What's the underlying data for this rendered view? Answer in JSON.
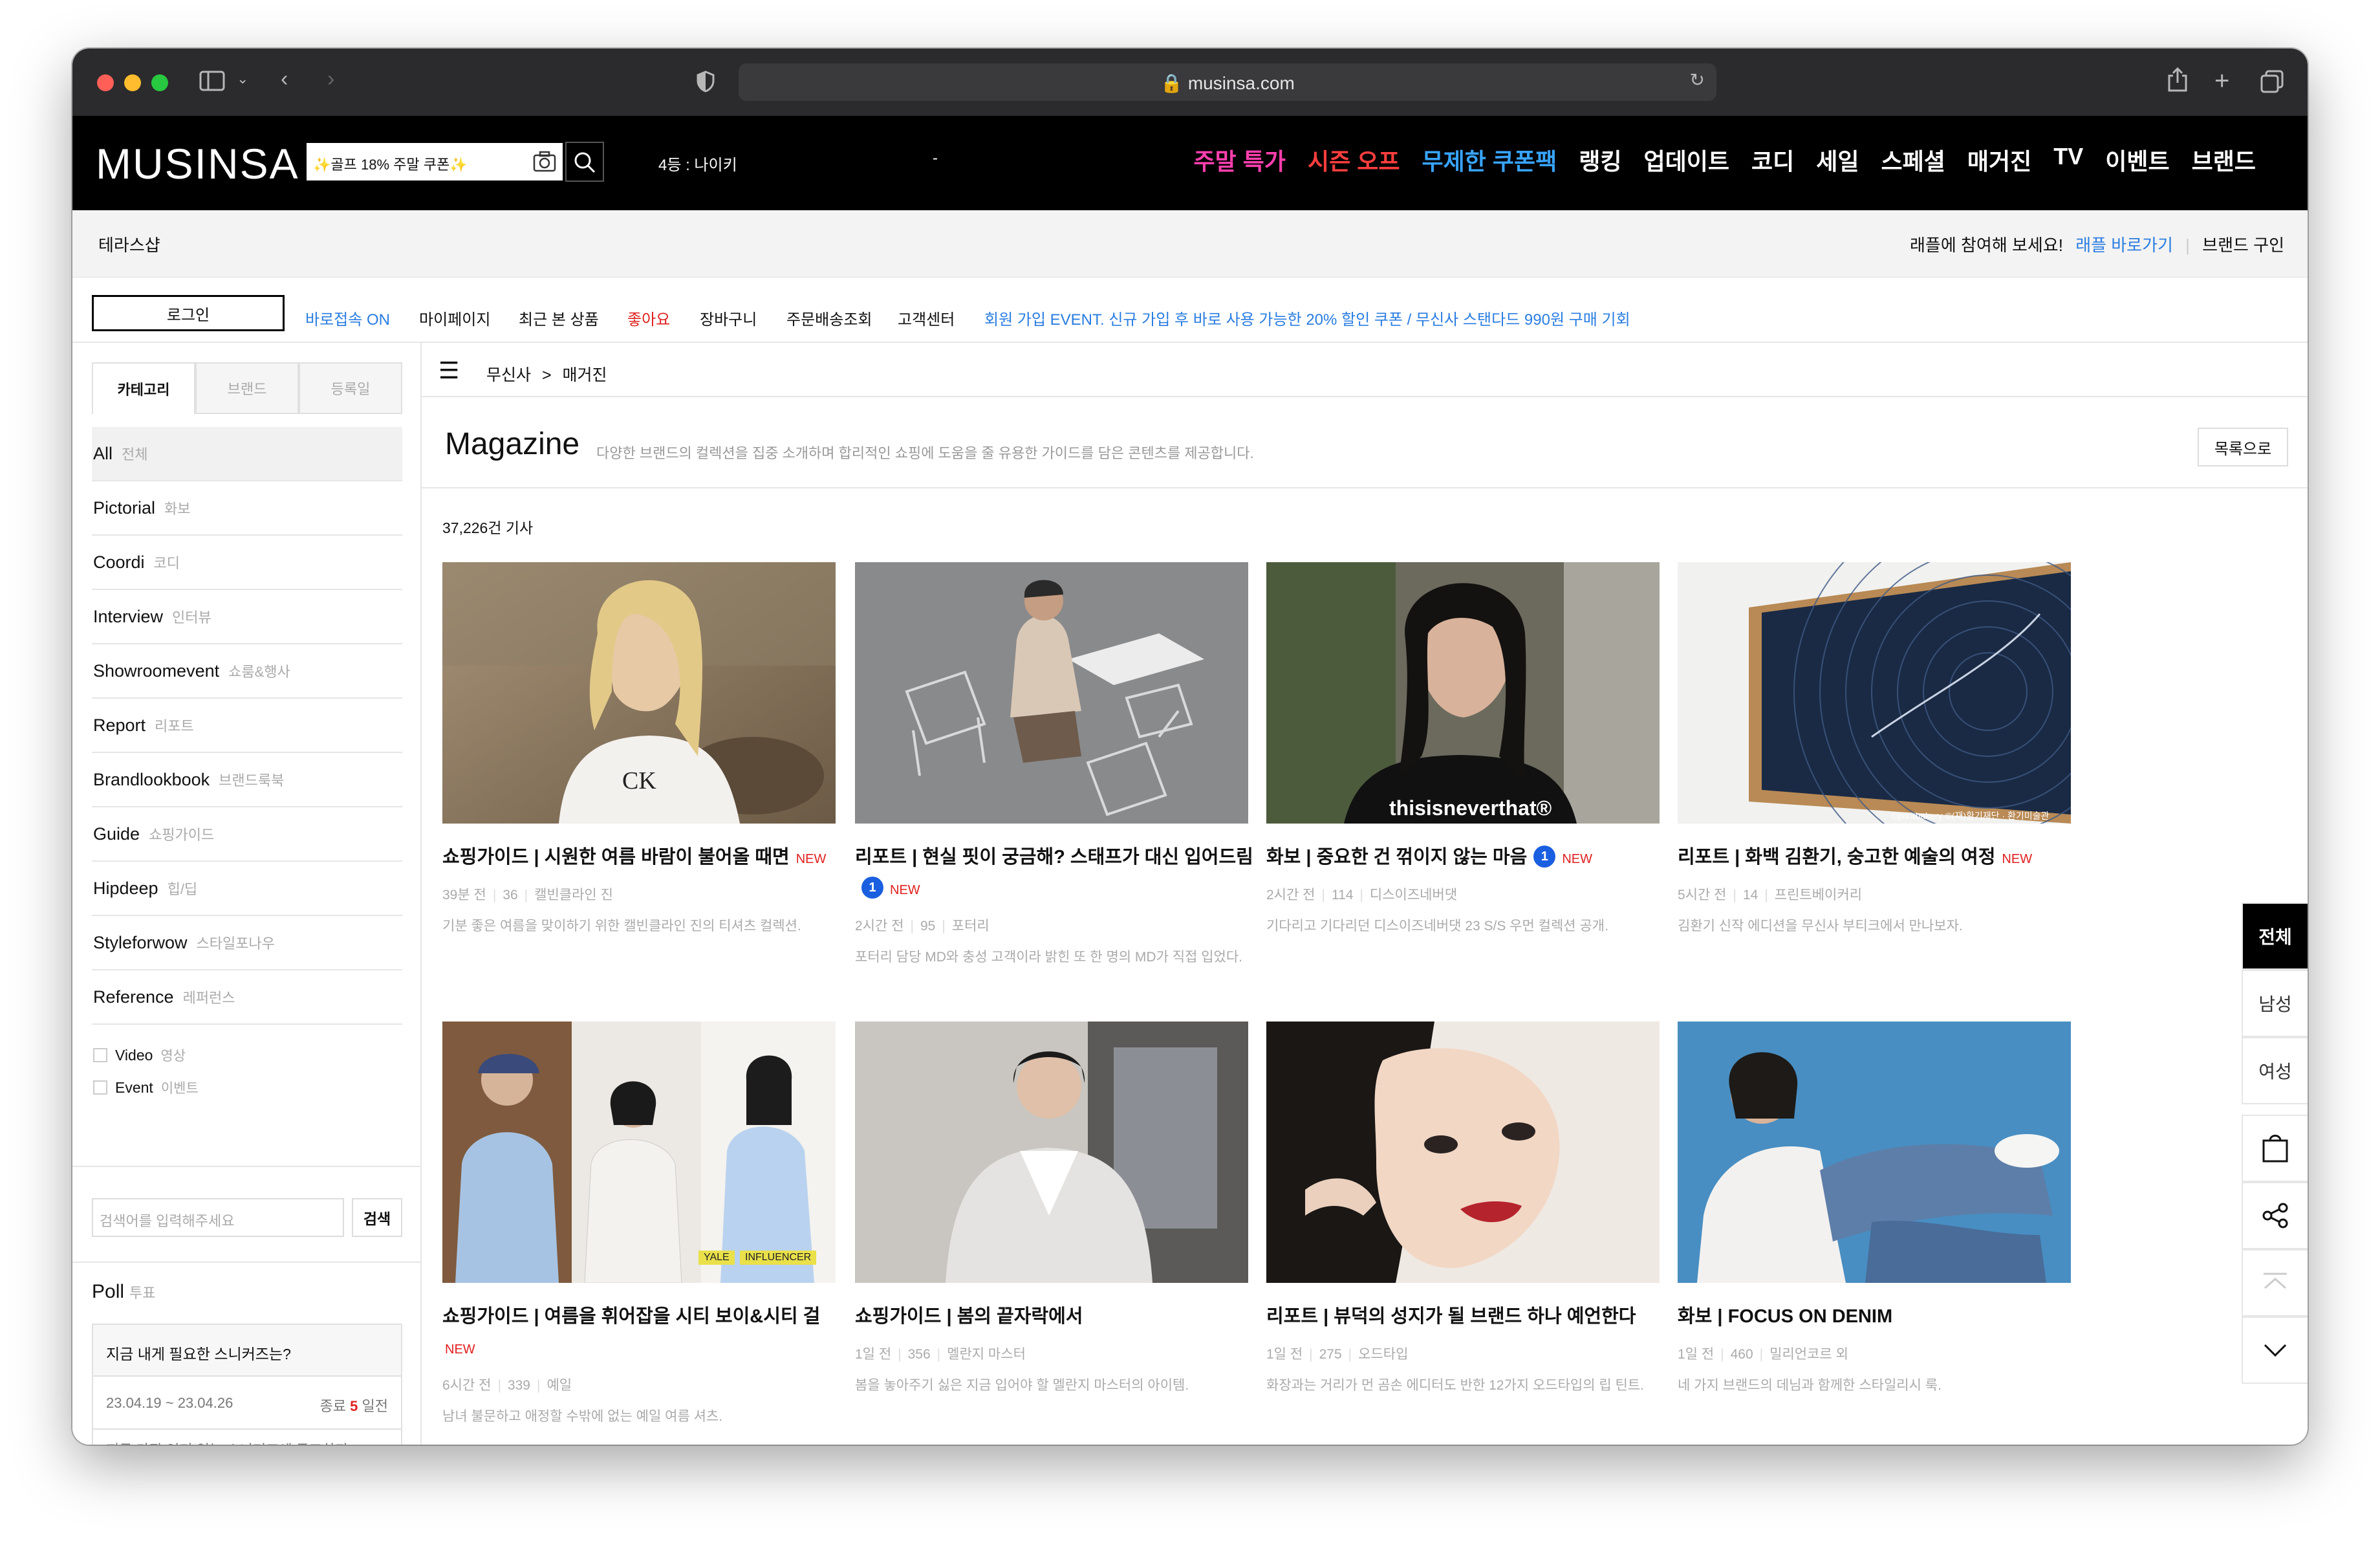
{
  "browser": {
    "url": "musinsa.com",
    "traffic_lights": [
      "#ff5f57",
      "#febc2e",
      "#28c840"
    ]
  },
  "header": {
    "logo": "MUSINSA",
    "search_placeholder": "✨골프 18% 주말 쿠폰✨",
    "rank_text": "4등 : 나이키",
    "rank_dash": "-",
    "nav": [
      {
        "label": "주말 특가",
        "color": "#ff3fae"
      },
      {
        "label": "시즌 오프",
        "color": "#ff3e3e"
      },
      {
        "label": "무제한 쿠폰팩",
        "color": "#38a4ff"
      },
      {
        "label": "랭킹",
        "color": "#ffffff"
      },
      {
        "label": "업데이트",
        "color": "#ffffff"
      },
      {
        "label": "코디",
        "color": "#ffffff"
      },
      {
        "label": "세일",
        "color": "#ffffff"
      },
      {
        "label": "스페셜",
        "color": "#ffffff"
      },
      {
        "label": "매거진",
        "color": "#ffffff"
      },
      {
        "label": "TV",
        "color": "#ffffff"
      },
      {
        "label": "이벤트",
        "color": "#ffffff"
      },
      {
        "label": "브랜드",
        "color": "#ffffff"
      }
    ]
  },
  "subbar": {
    "left": "테라스샵",
    "raffle_text": "래플에 참여해 보세요!",
    "raffle_link": "래플 바로가기",
    "brand_link": "브랜드 구인"
  },
  "util": {
    "login": "로그인",
    "quick_on": "바로접속 ON",
    "items": [
      "마이페이지",
      "최근 본 상품",
      "좋아요",
      "장바구니",
      "주문배송조회",
      "고객센터"
    ],
    "promo": "회원 가입 EVENT. 신규 가입 후 바로 사용 가능한 20% 할인 쿠폰 / 무신사 스탠다드 990원 구매 기회"
  },
  "sidebar": {
    "tabs": [
      "카테고리",
      "브랜드",
      "등록일"
    ],
    "categories": [
      {
        "en": "All",
        "ko": "전체"
      },
      {
        "en": "Pictorial",
        "ko": "화보"
      },
      {
        "en": "Coordi",
        "ko": "코디"
      },
      {
        "en": "Interview",
        "ko": "인터뷰"
      },
      {
        "en": "Showroomevent",
        "ko": "쇼룸&행사"
      },
      {
        "en": "Report",
        "ko": "리포트"
      },
      {
        "en": "Brandlookbook",
        "ko": "브랜드룩북"
      },
      {
        "en": "Guide",
        "ko": "쇼핑가이드"
      },
      {
        "en": "Hipdeep",
        "ko": "힙/딥"
      },
      {
        "en": "Styleforwow",
        "ko": "스타일포나우"
      },
      {
        "en": "Reference",
        "ko": "레퍼런스"
      }
    ],
    "checks": [
      {
        "en": "Video",
        "ko": "영상"
      },
      {
        "en": "Event",
        "ko": "이벤트"
      }
    ],
    "search_placeholder": "검색어를 입력해주세요",
    "search_button": "검색",
    "poll_title": "Poll",
    "poll_title_ko": "투표",
    "poll_question": "지금 내게 필요한 스니커즈는?",
    "poll_date": "23.04.19 ~ 23.04.26",
    "poll_end_prefix": "종료",
    "poll_end_days": "5",
    "poll_end_suffix": "일전",
    "poll_desc": "지금 가장 인기 있는 스니커즈에 투표하자."
  },
  "breadcrumb": {
    "home": "무신사",
    "sep": ">",
    "current": "매거진"
  },
  "magazine": {
    "title": "Magazine",
    "description": "다양한 브랜드의 컬렉션을 집중 소개하며 합리적인 쇼핑에 도움을 줄 유용한 가이드를 담은 콘텐츠를 제공합니다.",
    "list_button": "목록으로",
    "count": "37,226건 기사"
  },
  "articles": [
    {
      "title": "쇼핑가이드 | 시원한 여름 바람이 불어올 때면",
      "new": "NEW",
      "badge": "",
      "time": "39분 전",
      "views": "36",
      "author": "캘빈클라인 진",
      "desc": "기분 좋은 여름을 맞이하기 위한 캘빈클라인 진의 티셔츠 컬렉션."
    },
    {
      "title": "리포트 | 현실 핏이 궁금해? 스태프가 대신 입어드림",
      "new": "NEW",
      "badge": "1",
      "time": "2시간 전",
      "views": "95",
      "author": "포터리",
      "desc": "포터리 담당 MD와 충성 고객이라 밝힌 또 한 명의 MD가 직접 입었다."
    },
    {
      "title": "화보 | 중요한 건 꺾이지 않는 마음",
      "new": "NEW",
      "badge": "1",
      "time": "2시간 전",
      "views": "114",
      "author": "디스이즈네버댓",
      "desc": "기다리고 기다리던 디스이즈네버댓 23 S/S 우먼 컬렉션 공개."
    },
    {
      "title": "리포트 | 화백 김환기, 숭고한 예술의 여정",
      "new": "NEW",
      "badge": "",
      "time": "5시간 전",
      "views": "14",
      "author": "프린트베이커리",
      "desc": "김환기 신작 에디션을 무신사 부티크에서 만나보자."
    },
    {
      "title": "쇼핑가이드 | 여름을 휘어잡을 시티 보이&시티 걸",
      "new": "NEW",
      "badge": "",
      "time": "6시간 전",
      "views": "339",
      "author": "예일",
      "desc": "남녀 불문하고 애정할 수밖에 없는 예일 여름 셔츠."
    },
    {
      "title": "쇼핑가이드 | 봄의 끝자락에서",
      "new": "",
      "badge": "",
      "time": "1일 전",
      "views": "356",
      "author": "멜란지 마스터",
      "desc": "봄을 놓아주기 싫은 지금 입어야 할 멜란지 마스터의 아이템."
    },
    {
      "title": "리포트 | 뷰덕의 성지가 될 브랜드 하나 예언한다",
      "new": "",
      "badge": "",
      "time": "1일 전",
      "views": "275",
      "author": "오드타입",
      "desc": "화장과는 거리가 먼 곰손 에디터도 반한 12가지 오드타입의 립 틴트."
    },
    {
      "title": "화보 | FOCUS ON DENIM",
      "new": "",
      "badge": "",
      "time": "1일 전",
      "views": "460",
      "author": "밀리언코르 외",
      "desc": "네 가지 브랜드의 데님과 함께한 스타일리시 룩."
    }
  ],
  "thumb_text": {
    "a1_logo": "CK",
    "a3_print": "thisisneverthat®",
    "a4_credit": "©printbakery ©(재)환기재단 · 환기미술관",
    "a5_tag1": "YALE",
    "a5_tag2": "INFLUENCER"
  },
  "float": {
    "all": "전체",
    "men": "남성",
    "women": "여성"
  },
  "colors": {
    "accent_blue": "#1a5fe0",
    "new_red": "#e02020",
    "link_blue": "#2a7de1"
  }
}
